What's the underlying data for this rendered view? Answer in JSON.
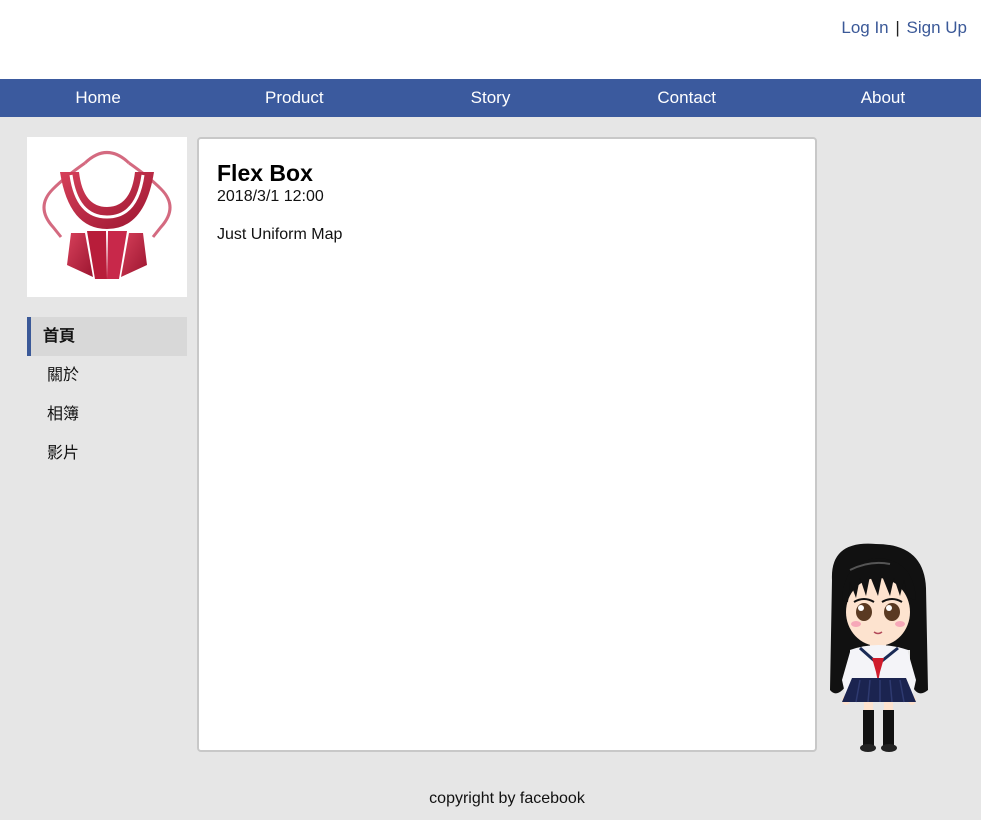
{
  "auth": {
    "login": "Log In",
    "separator": "|",
    "signup": "Sign Up"
  },
  "nav": {
    "items": [
      "Home",
      "Product",
      "Story",
      "Contact",
      "About"
    ]
  },
  "sidebar": {
    "items": [
      "首頁",
      "關於",
      "相簿",
      "影片"
    ],
    "active_index": 0
  },
  "post": {
    "title": "Flex Box",
    "date": "2018/3/1 12:00",
    "body": "Just Uniform Map"
  },
  "footer": {
    "text": "copyright by facebook"
  },
  "colors": {
    "nav_bg": "#3b5a9e",
    "link": "#3b5998",
    "logo_red": "#c0203c",
    "page_bg": "#e6e6e6"
  },
  "icons": {
    "logo": "sailor-uniform-logo",
    "mascot": "schoolgirl-mascot"
  }
}
